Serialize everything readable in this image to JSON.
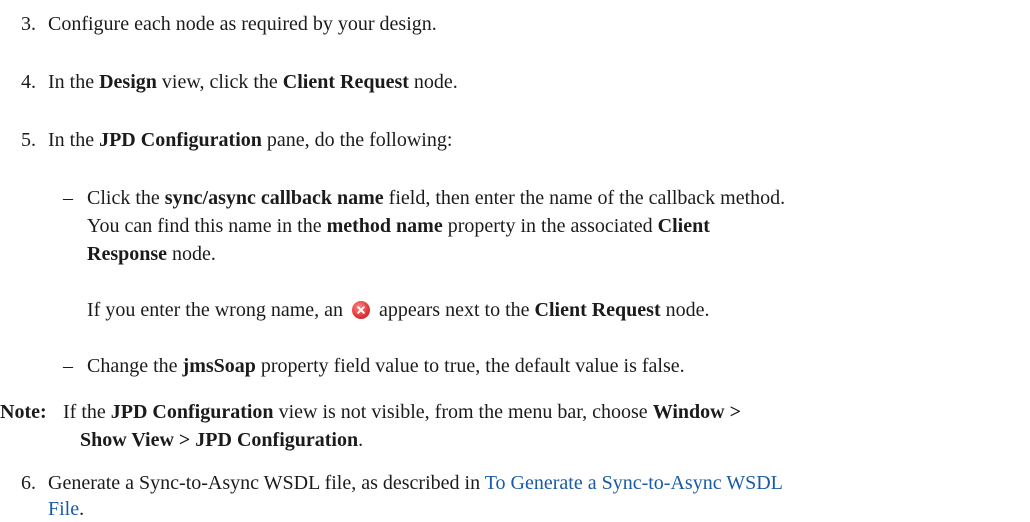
{
  "steps": {
    "s3": {
      "num": "3.",
      "text": "Configure each node as required by your design."
    },
    "s4": {
      "num": "4.",
      "a": "In the ",
      "b1": "Design",
      "c": " view, click the ",
      "b2": "Client Request",
      "d": " node."
    },
    "s5": {
      "num": "5.",
      "a": "In the ",
      "b1": "JPD Configuration",
      "c": " pane, do the following:"
    },
    "sub1": {
      "dash": "–",
      "l1a": "Click the ",
      "l1b": "sync/async callback name",
      "l1c": " field, then enter the name of the callback method.",
      "l2a": "You can find this name in the ",
      "l2b": "method name",
      "l2c": " property in the associated ",
      "l2d": "Client",
      "l3a": "Response",
      "l3b": " node."
    },
    "wrong": {
      "a": "If you enter the wrong name, an",
      "b": "appears next to the ",
      "c": "Client Request",
      "d": " node.",
      "icon": "error-x-icon"
    },
    "sub2": {
      "dash": "–",
      "a": "Change the ",
      "b": "jmsSoap",
      "c": " property field value to true, the default value is false."
    },
    "note": {
      "label": "Note:",
      "l1a": "If the ",
      "l1b": "JPD Configuration",
      "l1c": " view is not visible, from the menu bar, choose ",
      "l1d": "Window >",
      "l2a": "Show View > JPD Configuration",
      "l2b": "."
    },
    "s6": {
      "num": "6.",
      "a": "Generate a Sync-to-Async WSDL file, as described in ",
      "link1": "To Generate a Sync-to-Async WSDL",
      "link2": "File",
      "end": "."
    }
  },
  "colors": {
    "text": "#1b1b1b",
    "link": "#1a5aa6",
    "error_icon": "#e23b3b"
  }
}
